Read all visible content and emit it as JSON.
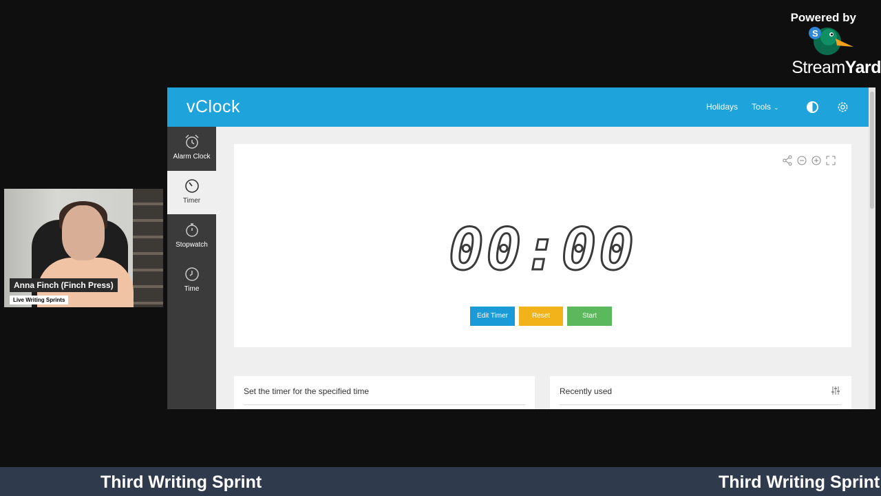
{
  "branding": {
    "powered_by": "Powered by",
    "name_light": "Stream",
    "name_bold": "Yard"
  },
  "camera": {
    "display_name": "Anna Finch (Finch Press)",
    "caption": "Live Writing Sprints"
  },
  "app": {
    "logo": "vClock",
    "nav": {
      "holidays": "Holidays",
      "tools": "Tools"
    },
    "sidebar": [
      {
        "label": "Alarm Clock",
        "icon": "alarm-clock-icon"
      },
      {
        "label": "Timer",
        "icon": "timer-icon",
        "active": true
      },
      {
        "label": "Stopwatch",
        "icon": "stopwatch-icon"
      },
      {
        "label": "Time",
        "icon": "clock-icon"
      }
    ],
    "timer": {
      "display": "00:00",
      "buttons": {
        "edit": "Edit Timer",
        "reset": "Reset",
        "start": "Start"
      }
    },
    "panels": {
      "set_timer_title": "Set the timer for the specified time",
      "recently_used_title": "Recently used"
    },
    "colors": {
      "header": "#1ea3db",
      "edit_button": "#1a9ad6",
      "reset_button": "#f1b21a",
      "start_button": "#5cb85c",
      "sidebar": "#3b3b3b"
    }
  },
  "ticker": {
    "text": "Third Writing Sprint"
  }
}
